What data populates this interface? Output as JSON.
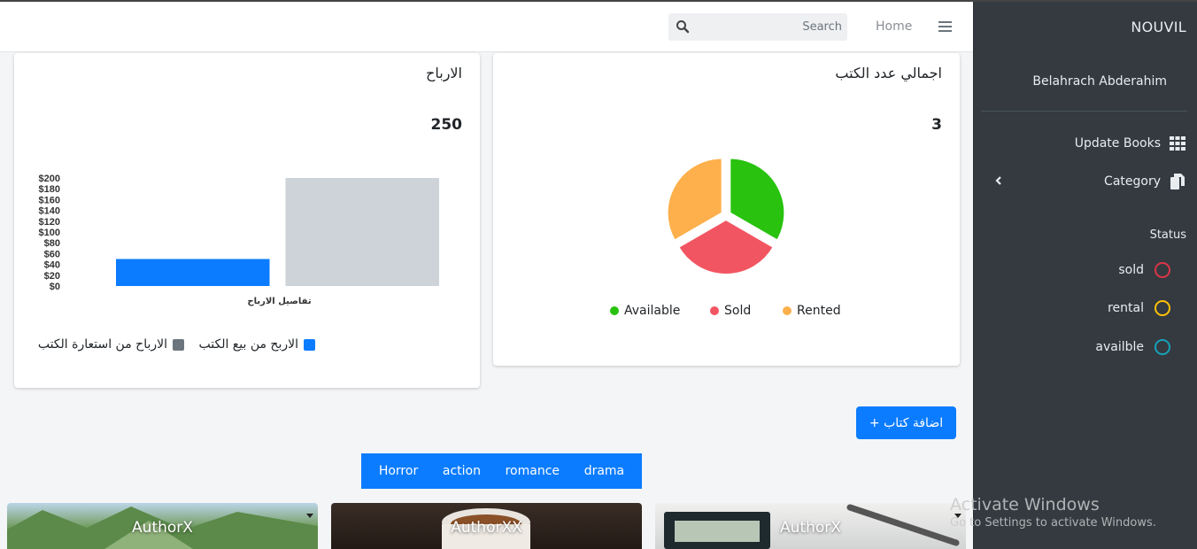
{
  "search": {
    "placeholder": "Search"
  },
  "nav": {
    "home_label": "Home"
  },
  "sidebar": {
    "brand": "NOUVIL",
    "user_name": "Belahrach Abderahim",
    "items": [
      {
        "label": "Update Books",
        "icon": "grid-icon"
      },
      {
        "label": "Category",
        "icon": "copy-icon"
      }
    ],
    "status_title": "Status",
    "statuses": [
      {
        "label": "sold",
        "color": "#dc3545"
      },
      {
        "label": "rental",
        "color": "#ffc107"
      },
      {
        "label": "availble",
        "color": "#17a2b8"
      }
    ]
  },
  "profit_card": {
    "title": "الارباح",
    "value": "250",
    "legend": [
      {
        "label": "الاربح من بيع الكتب",
        "color": "#0b7cff"
      },
      {
        "label": "الارباح من استعارة الكتب",
        "color": "#6c757d"
      }
    ]
  },
  "books_card": {
    "title": "اجمالي عدد الكتب",
    "value": "3",
    "legend": [
      {
        "label": "Available",
        "color": "#28c20f"
      },
      {
        "label": "Sold",
        "color": "#f25562"
      },
      {
        "label": "Rented",
        "color": "#fdb04b"
      }
    ]
  },
  "add_button_label": "+ اضافة كتاب",
  "genres": [
    "Horror",
    "action",
    "romance",
    "drama"
  ],
  "books": [
    {
      "author": "AuthorX"
    },
    {
      "author": "AuthorXX"
    },
    {
      "author": "AuthorX"
    }
  ],
  "watermark": {
    "line1": "Activate Windows",
    "line2": "Go to Settings to activate Windows."
  },
  "chart_data": [
    {
      "type": "bar",
      "categories": [
        "تفاصيل الارباح"
      ],
      "series": [
        {
          "name": "الاربح من بيع الكتب",
          "values": [
            50
          ],
          "color": "#0b7cff"
        },
        {
          "name": "الارباح من استعارة الكتب",
          "values": [
            200
          ],
          "color": "#ced3da"
        }
      ],
      "ylim": [
        0,
        200
      ],
      "yticks": [
        "$0",
        "$20",
        "$40",
        "$60",
        "$80",
        "$100",
        "$120",
        "$140",
        "$160",
        "$180",
        "$200"
      ],
      "xlabel": "تفاصيل الارباح"
    },
    {
      "type": "pie",
      "labels": [
        "Available",
        "Sold",
        "Rented"
      ],
      "values": [
        1,
        1,
        1
      ],
      "colors": [
        "#28c20f",
        "#f25562",
        "#fdb04b"
      ]
    }
  ]
}
